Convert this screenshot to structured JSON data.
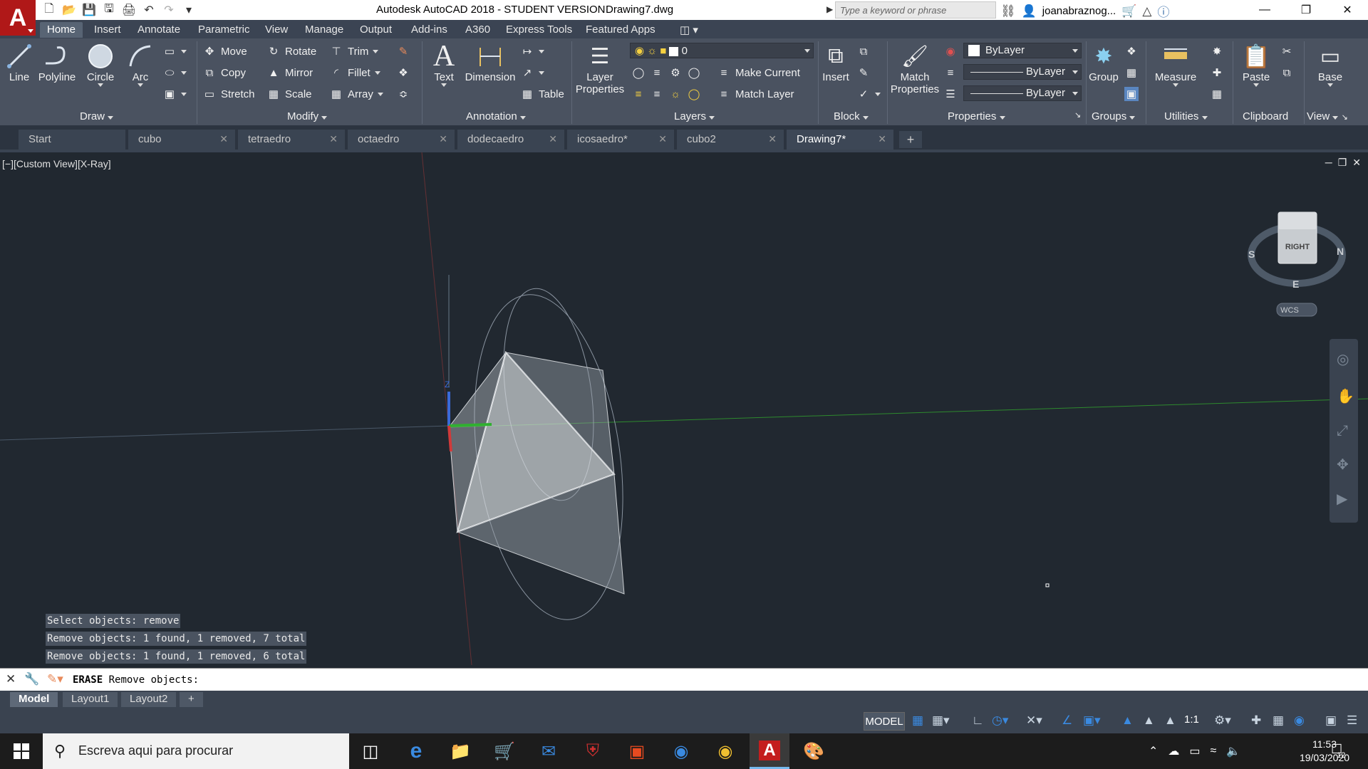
{
  "titlebar": {
    "app_title": "Autodesk AutoCAD 2018 - STUDENT VERSION",
    "file_name": "Drawing7.dwg",
    "search_placeholder": "Type a keyword or phrase",
    "user_name": "joanabraznog..."
  },
  "ribbon_tabs": [
    "Home",
    "Insert",
    "Annotate",
    "Parametric",
    "View",
    "Manage",
    "Output",
    "Add-ins",
    "A360",
    "Express Tools",
    "Featured Apps"
  ],
  "ribbon": {
    "draw": {
      "label": "Draw",
      "line": "Line",
      "polyline": "Polyline",
      "circle": "Circle",
      "arc": "Arc"
    },
    "modify": {
      "label": "Modify",
      "move": "Move",
      "rotate": "Rotate",
      "trim": "Trim",
      "copy": "Copy",
      "mirror": "Mirror",
      "fillet": "Fillet",
      "stretch": "Stretch",
      "scale": "Scale",
      "array": "Array"
    },
    "annotation": {
      "label": "Annotation",
      "text": "Text",
      "dimension": "Dimension",
      "table": "Table"
    },
    "layers": {
      "label": "Layers",
      "layer_properties_1": "Layer",
      "layer_properties_2": "Properties",
      "current_layer": "0",
      "make_current": "Make Current",
      "match_layer": "Match Layer"
    },
    "block": {
      "label": "Block",
      "insert": "Insert"
    },
    "properties": {
      "label": "Properties",
      "match_1": "Match",
      "match_2": "Properties",
      "color": "ByLayer",
      "linetype": "ByLayer",
      "lineweight": "ByLayer"
    },
    "groups": {
      "label": "Groups",
      "group": "Group"
    },
    "utilities": {
      "label": "Utilities",
      "measure": "Measure"
    },
    "clipboard": {
      "label": "Clipboard",
      "paste": "Paste"
    },
    "view": {
      "label": "View",
      "base": "Base"
    }
  },
  "file_tabs": [
    {
      "label": "Start"
    },
    {
      "label": "cubo"
    },
    {
      "label": "tetraedro"
    },
    {
      "label": "octaedro"
    },
    {
      "label": "dodecaedro"
    },
    {
      "label": "icosaedro*"
    },
    {
      "label": "cubo2"
    },
    {
      "label": "Drawing7*"
    }
  ],
  "viewport": {
    "label": "[−][Custom View][X-Ray]",
    "viewcube_face": "RIGHT",
    "compass_s": "S",
    "compass_n": "N",
    "compass_e": "E",
    "wcs": "WCS",
    "axis_z": "Z"
  },
  "command": {
    "history": [
      "Select objects: remove",
      "Remove objects: 1 found, 1 removed, 7 total",
      "Remove objects: 1 found, 1 removed, 6 total"
    ],
    "prompt_cmd": "ERASE",
    "prompt_text": " Remove objects:"
  },
  "layout_tabs": [
    "Model",
    "Layout1",
    "Layout2"
  ],
  "statusbar": {
    "model": "MODEL",
    "scale": "1:1"
  },
  "taskbar": {
    "search_placeholder": "Escreva aqui para procurar",
    "time": "11:53",
    "date": "19/03/2020",
    "notifications": "12"
  },
  "colors": {
    "accent_red": "#b01818",
    "ribbon_bg": "#4a5260",
    "viewport_bg": "#212830"
  }
}
